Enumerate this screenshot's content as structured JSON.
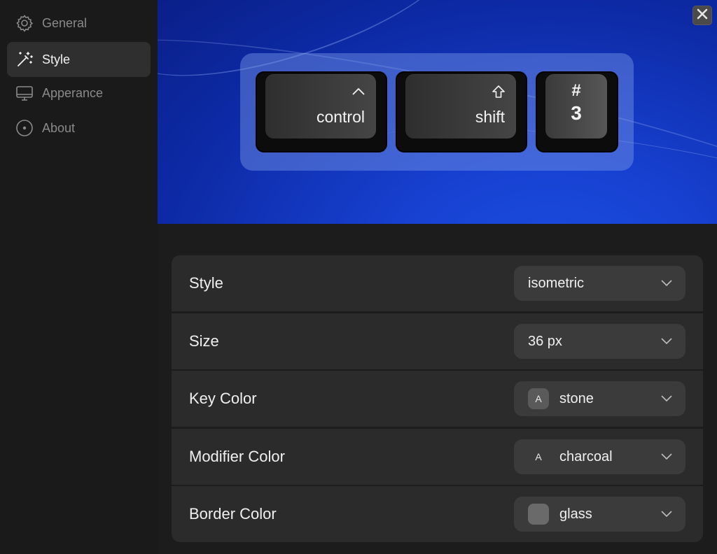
{
  "sidebar": {
    "items": [
      {
        "label": "General",
        "icon": "gear-icon"
      },
      {
        "label": "Style",
        "icon": "magic-wand-icon",
        "active": true
      },
      {
        "label": "Apperance",
        "icon": "monitor-icon"
      },
      {
        "label": "About",
        "icon": "info-circle-icon"
      }
    ]
  },
  "preview": {
    "keys": [
      {
        "symbol": "^",
        "label": "control"
      },
      {
        "symbol": "⇧",
        "label": "shift"
      },
      {
        "top": "#",
        "bottom": "3"
      }
    ]
  },
  "settings": {
    "rows": [
      {
        "label": "Style",
        "value": "isometric"
      },
      {
        "label": "Size",
        "value": "36 px"
      },
      {
        "label": "Key Color",
        "value": "stone",
        "swatch_text": "A",
        "swatch_color": "#5a5a5a"
      },
      {
        "label": "Modifier Color",
        "value": "charcoal",
        "swatch_text": "A",
        "swatch_color": "#3b3b3b"
      },
      {
        "label": "Border Color",
        "value": "glass",
        "swatch_text": "",
        "swatch_color": "#6a6a6a"
      }
    ]
  },
  "colors": {
    "accent_blue": "#1740d0",
    "panel": "#2b2b2b",
    "select": "#3b3b3b"
  }
}
